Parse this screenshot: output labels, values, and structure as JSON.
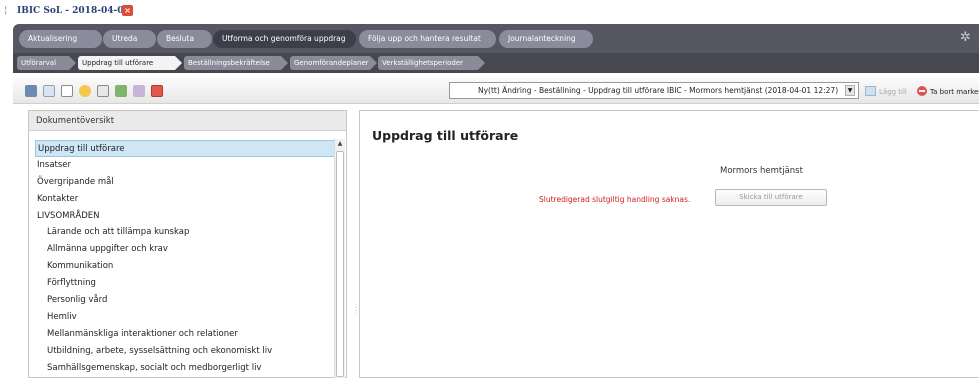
{
  "window": {
    "title": "IBIC SoL - 2018-04-01"
  },
  "phases": [
    {
      "label": "Aktualisering",
      "active": false
    },
    {
      "label": "Utreda",
      "active": false
    },
    {
      "label": "Besluta",
      "active": false
    },
    {
      "label": "Utforma och genomföra uppdrag",
      "active": true
    },
    {
      "label": "Följa upp och hantera resultat",
      "active": false
    },
    {
      "label": "Journalanteckning",
      "active": false
    }
  ],
  "steps": [
    {
      "label": "Utförarval",
      "active": false
    },
    {
      "label": "Uppdrag till utförare",
      "active": true
    },
    {
      "label": "Beställningsbekräftelse",
      "active": false
    },
    {
      "label": "Genomförandeplaner",
      "active": false
    },
    {
      "label": "Verkställighetsperioder",
      "active": false
    }
  ],
  "toolbar": {
    "document_select": "Ny(tt) Ändring - Beställning - Uppdrag till utförare IBIC - Mormors hemtjänst (2018-04-01 12:27)",
    "add_label": "Lägg till",
    "remove_label": "Ta bort markerad"
  },
  "overview": {
    "header": "Dokumentöversikt",
    "items": [
      {
        "label": "Uppdrag till utförare",
        "selected": true,
        "indent": false
      },
      {
        "label": "Insatser",
        "selected": false,
        "indent": false
      },
      {
        "label": "Övergripande mål",
        "selected": false,
        "indent": false
      },
      {
        "label": "Kontakter",
        "selected": false,
        "indent": false
      },
      {
        "label": "LIVSOMRÅDEN",
        "selected": false,
        "indent": false
      },
      {
        "label": "Lärande och att tillämpa kunskap",
        "selected": false,
        "indent": true
      },
      {
        "label": "Allmänna uppgifter och krav",
        "selected": false,
        "indent": true
      },
      {
        "label": "Kommunikation",
        "selected": false,
        "indent": true
      },
      {
        "label": "Förflyttning",
        "selected": false,
        "indent": true
      },
      {
        "label": "Personlig vård",
        "selected": false,
        "indent": true
      },
      {
        "label": "Hemliv",
        "selected": false,
        "indent": true
      },
      {
        "label": "Mellanmänskliga interaktioner och relationer",
        "selected": false,
        "indent": true
      },
      {
        "label": "Utbildning, arbete, sysselsättning och ekonomiskt liv",
        "selected": false,
        "indent": true
      },
      {
        "label": "Samhällsgemenskap, socialt och medborgerligt liv",
        "selected": false,
        "indent": true
      }
    ]
  },
  "main": {
    "title": "Uppdrag till utförare",
    "provider": "Mormors hemtjänst",
    "warning": "Slutredigerad slutgiltig handling saknas.",
    "send_button": "Skicka till utförare"
  },
  "colors": {
    "phase_bar": "#575763",
    "phase_active": "#3e3e4a",
    "selection": "#cfe6f4",
    "warning": "#d01e1e"
  }
}
